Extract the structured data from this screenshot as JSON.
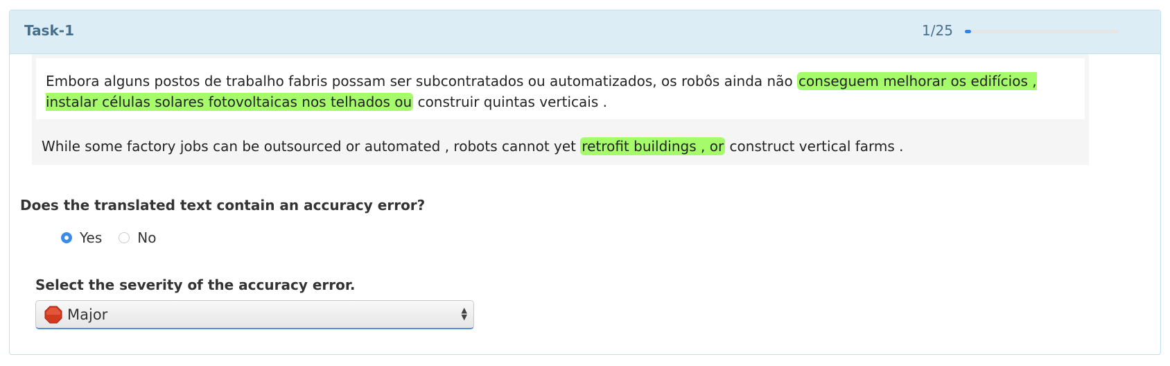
{
  "header": {
    "title": "Task-1",
    "progress_text": "1/25",
    "progress_fraction": 0.04
  },
  "source": {
    "before": "Embora alguns postos de trabalho fabris possam ser subcontratados ou automatizados, os robôs ainda não ",
    "highlight": "conseguem melhorar os edifícios , instalar células solares fotovoltaicas nos telhados ou",
    "after": " construir quintas verticais ."
  },
  "target": {
    "before": "While some factory jobs can be outsourced or automated , robots cannot yet ",
    "highlight": "retrofit buildings , or",
    "after": " construct vertical farms ."
  },
  "question": {
    "text": "Does the translated text contain an accuracy error?",
    "options": [
      {
        "label": "Yes",
        "checked": true
      },
      {
        "label": "No",
        "checked": false
      }
    ]
  },
  "severity": {
    "label": "Select the severity of the accuracy error.",
    "selected": "Major",
    "icon": "stop-sign-icon"
  },
  "colors": {
    "highlight": "#a5fb6a",
    "header_bg": "#dcedf5",
    "accent": "#3b8be8"
  }
}
